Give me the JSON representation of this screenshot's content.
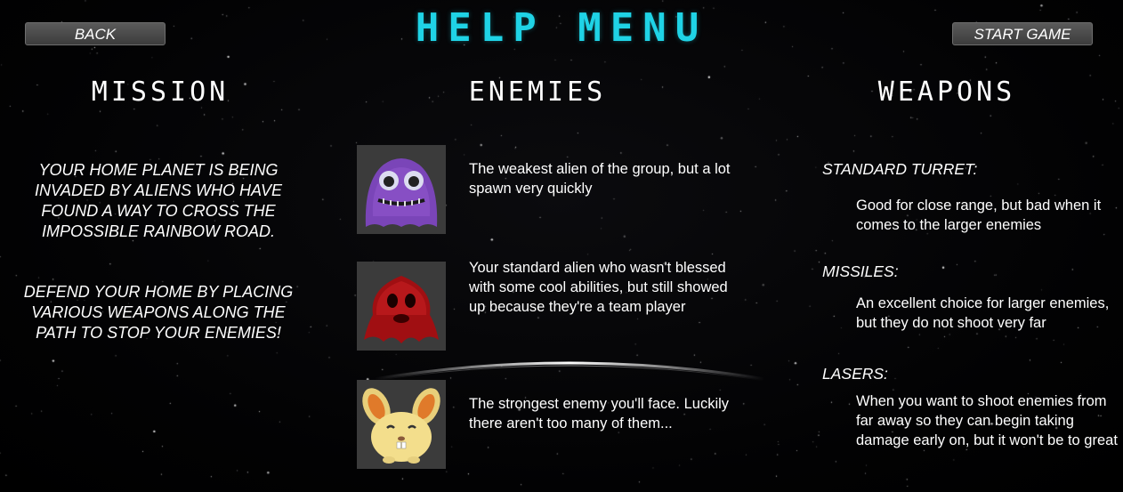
{
  "header": {
    "title": "HELP MENU",
    "back_label": "BACK",
    "start_label": "START GAME"
  },
  "mission": {
    "heading": "MISSION",
    "paragraph1": "YOUR HOME PLANET IS BEING INVADED BY ALIENS WHO HAVE FOUND A WAY TO CROSS THE IMPOSSIBLE RAINBOW ROAD.",
    "paragraph2": "DEFEND YOUR HOME BY PLACING VARIOUS WEAPONS ALONG THE PATH TO STOP YOUR ENEMIES!"
  },
  "enemies": {
    "heading": "ENEMIES",
    "items": [
      {
        "icon": "purple-alien-icon",
        "description": "The weakest alien of the group, but a lot spawn very quickly"
      },
      {
        "icon": "red-alien-icon",
        "description": "Your standard alien who wasn't blessed with some cool abilities, but still showed up because they're a team player"
      },
      {
        "icon": "yellow-bunny-alien-icon",
        "description": "The strongest enemy you'll face. Luckily there aren't too many of them..."
      }
    ]
  },
  "weapons": {
    "heading": "WEAPONS",
    "items": [
      {
        "name": "STANDARD TURRET:",
        "description": "Good for close range, but bad when it comes to the larger enemies"
      },
      {
        "name": "MISSILES:",
        "description": "An excellent choice for larger enemies, but they do not shoot very far"
      },
      {
        "name": "LASERS:",
        "description": "When you want to shoot enemies from far away so they can begin taking damage early on, but it won't be to great"
      }
    ]
  },
  "colors": {
    "title": "#1fd3e6",
    "background": "#000000",
    "button": "#4a4a4a",
    "text": "#ffffff"
  }
}
